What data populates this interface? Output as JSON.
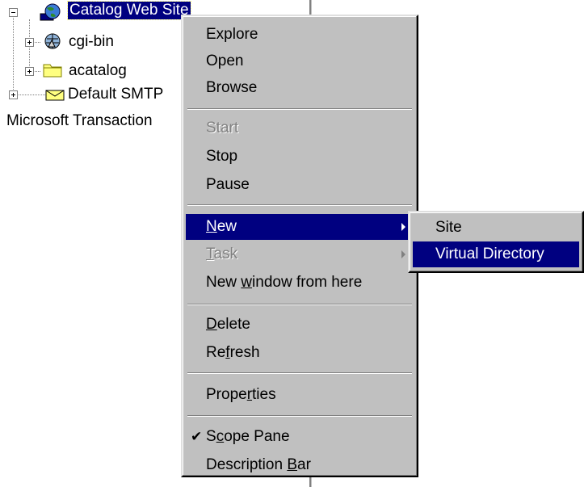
{
  "tree": {
    "nodes": [
      {
        "label": "Catalog Web Site",
        "icon": "globe-icon",
        "selected": true,
        "expanded": true
      },
      {
        "label": "cgi-bin",
        "icon": "web-folder-icon"
      },
      {
        "label": "acatalog",
        "icon": "folder-icon"
      },
      {
        "label": "Default SMTP",
        "icon": "smtp-envelope-icon"
      },
      {
        "label": "Microsoft Transaction"
      }
    ]
  },
  "context_menu": {
    "explore": "Explore",
    "open": "Open",
    "browse": "Browse",
    "start": "Start",
    "stop": "Stop",
    "pause": "Pause",
    "new_pre": "",
    "new_key": "N",
    "new_post": "ew",
    "task_pre": "",
    "task_key": "T",
    "task_post": "ask",
    "new_window_pre": "New ",
    "new_window_key": "w",
    "new_window_post": "indow from here",
    "delete_pre": "",
    "delete_key": "D",
    "delete_post": "elete",
    "refresh_pre": "Re",
    "refresh_key": "f",
    "refresh_post": "resh",
    "properties_pre": "Prope",
    "properties_key": "r",
    "properties_post": "ties",
    "scope_pane_pre": "S",
    "scope_pane_key": "c",
    "scope_pane_post": "ope Pane",
    "scope_pane_checked": true,
    "description_bar_pre": "Description ",
    "description_bar_key": "B",
    "description_bar_post": "ar"
  },
  "submenu_new": {
    "site": "Site",
    "virtual_directory": "Virtual Directory"
  },
  "colors": {
    "menu_face": "#c0c0c0",
    "highlight": "#000080",
    "highlight_text": "#ffffff",
    "disabled_text": "#808080"
  }
}
